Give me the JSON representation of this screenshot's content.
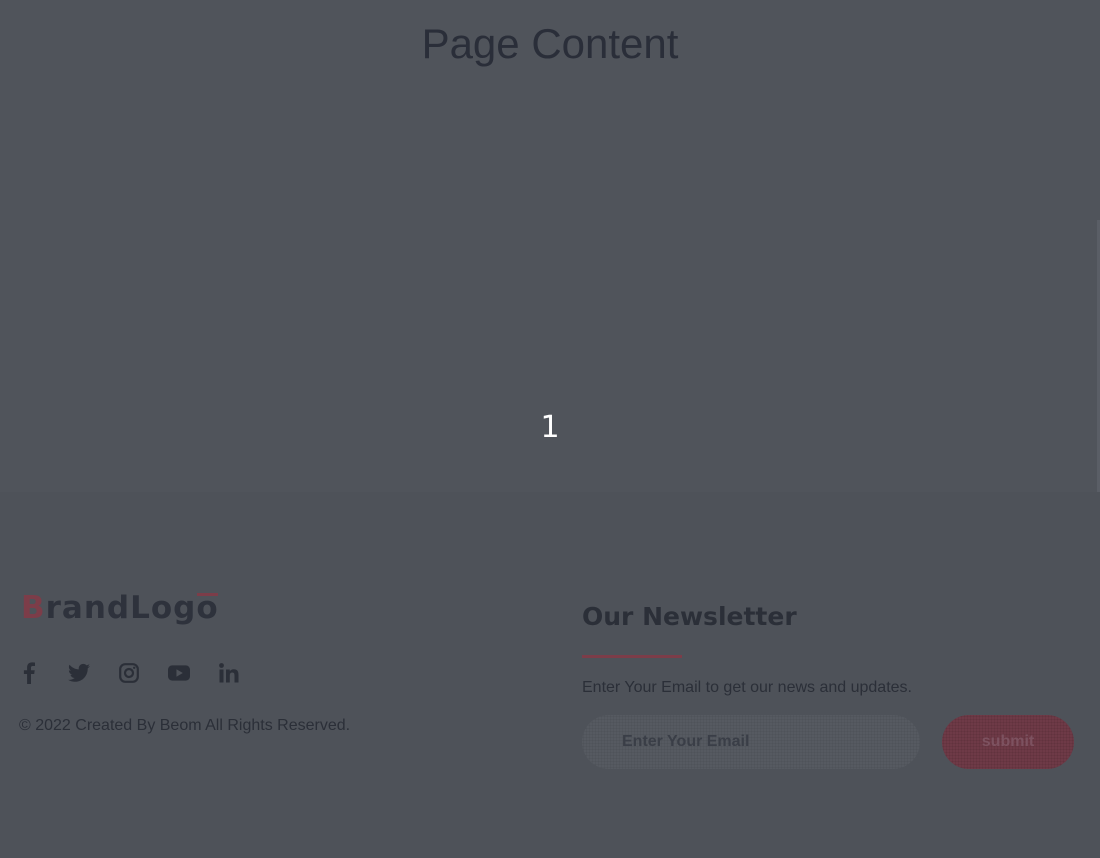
{
  "main": {
    "title": "Page Content",
    "page_number": "1"
  },
  "footer": {
    "brand": {
      "first_letter": "B",
      "middle": "randLog",
      "last_letter": "o"
    },
    "socials": [
      {
        "icon": "facebook-icon"
      },
      {
        "icon": "twitter-icon"
      },
      {
        "icon": "instagram-icon"
      },
      {
        "icon": "youtube-icon"
      },
      {
        "icon": "linkedin-icon"
      }
    ],
    "copyright": "© 2022 Created By Beom All Rights Reserved.",
    "newsletter": {
      "title": "Our Newsletter",
      "description": "Enter Your Email to get our news and updates.",
      "email_placeholder": "Enter Your Email",
      "submit_label": "submit"
    }
  },
  "colors": {
    "background": "#4f535b",
    "text_dark": "#2b2f38",
    "accent": "#7c3d49",
    "button": "#6e3a47"
  }
}
